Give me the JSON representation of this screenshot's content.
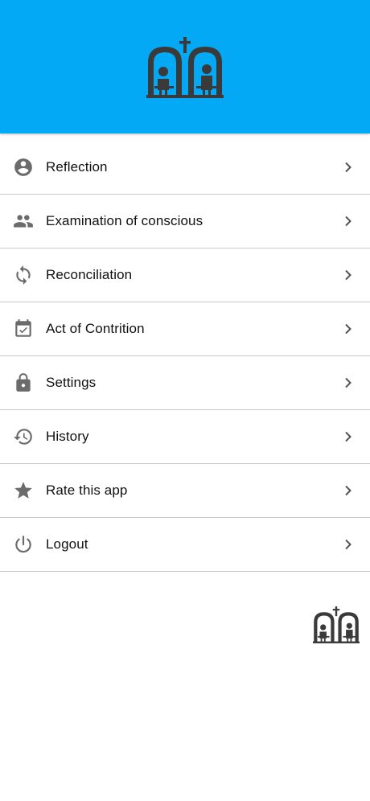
{
  "header": {
    "background_color": "#03A9F4",
    "logo_icon": "church-confessional-logo"
  },
  "menu": {
    "items": [
      {
        "label": "Reflection",
        "icon": "account-circle-icon"
      },
      {
        "label": "Examination of conscious",
        "icon": "people-icon"
      },
      {
        "label": "Reconciliation",
        "icon": "sync-icon"
      },
      {
        "label": "Act of Contrition",
        "icon": "calendar-check-icon"
      },
      {
        "label": "Settings",
        "icon": "lock-icon"
      },
      {
        "label": "History",
        "icon": "history-icon"
      },
      {
        "label": "Rate this app",
        "icon": "star-icon"
      },
      {
        "label": "Logout",
        "icon": "power-icon"
      }
    ],
    "chevron_icon": "chevron-right-icon",
    "icon_color": "#6b6b6b"
  },
  "footer": {
    "logo_icon": "church-confessional-logo"
  }
}
